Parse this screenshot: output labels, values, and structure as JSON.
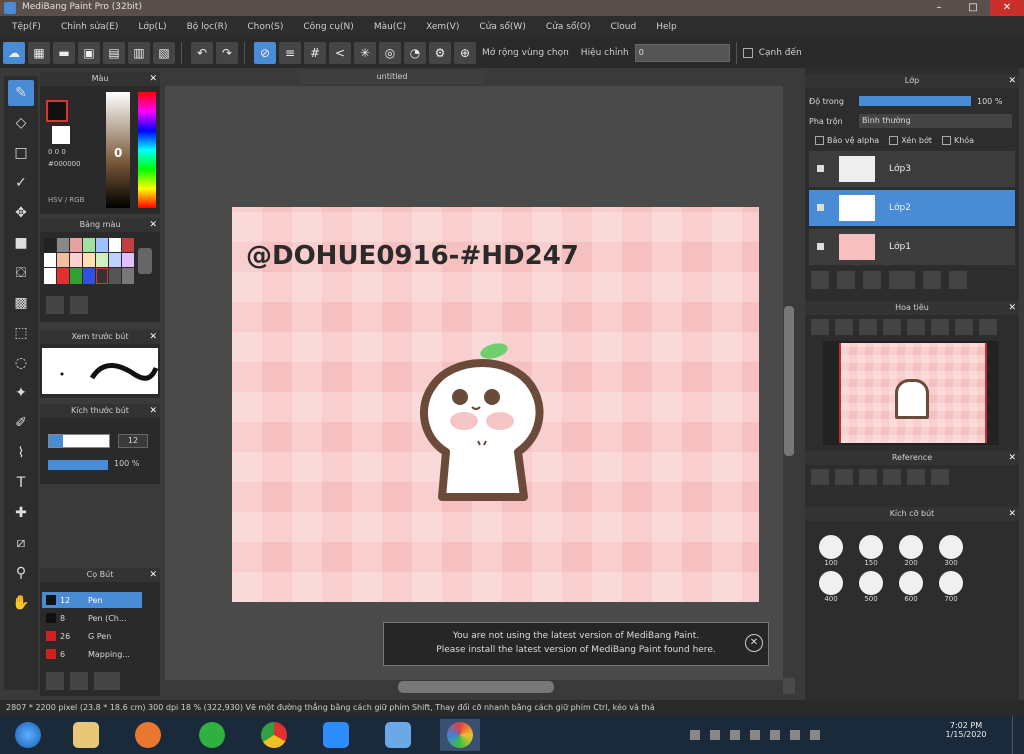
{
  "title_bar": {
    "title": "MediBang Paint Pro (32bit)"
  },
  "window_controls": {
    "minimize": "–",
    "maximize": "□",
    "close": "✕"
  },
  "menu": [
    "Tệp(F)",
    "Chỉnh sửa(E)",
    "Lớp(L)",
    "Bộ lọc(R)",
    "Chọn(S)",
    "Công cụ(N)",
    "Màu(C)",
    "Xem(V)",
    "Cửa sổ(W)",
    "Cửa sổ(O)",
    "Cloud",
    "Help"
  ],
  "toolbar": {
    "undo_icon": "↶",
    "redo_icon": "↷",
    "antialias_label": "Mở rộng vùng chọn",
    "correction_label": "Hiệu chỉnh",
    "correction_value": "0",
    "snap_label": "Cạnh đến"
  },
  "canvas_tab": "untitled",
  "left_panels": {
    "color": {
      "title": "Màu",
      "value": "0",
      "rgb_line1": "0 0 0",
      "hex": "#000000",
      "mode_toggle": "HSV / RGB"
    },
    "palette": {
      "title": "Bảng màu"
    },
    "brush_preview": {
      "title": "Xem trước bút"
    },
    "brush_size": {
      "title": "Kích thước bút",
      "size_value": "12",
      "opacity_value": "100 %"
    },
    "brushes": {
      "title": "Cọ Bút",
      "items": [
        {
          "size": "12",
          "name": "Pen"
        },
        {
          "size": "8",
          "name": "Pen (Ch..."
        },
        {
          "size": "26",
          "name": "G Pen"
        },
        {
          "size": "6",
          "name": "Mapping..."
        }
      ]
    }
  },
  "artboard": {
    "watermark_text": "@DOHUE0916-#HD247"
  },
  "right_panels": {
    "layers": {
      "title": "Lớp",
      "opacity_label": "Độ trong",
      "opacity_value": "100 %",
      "blend_label": "Pha trộn",
      "blend_value": "Bình thường",
      "options": [
        "Bảo vệ alpha",
        "Xén bớt",
        "Khóa"
      ],
      "items": [
        {
          "name": "Lớp3",
          "selected": false
        },
        {
          "name": "Lớp2",
          "selected": true
        },
        {
          "name": "Lớp1",
          "selected": false
        }
      ]
    },
    "navigator": {
      "title": "Hoa tiêu"
    },
    "reference": {
      "title": "Reference"
    },
    "brush_size_panel": {
      "title": "Kích cỡ bút",
      "sizes": [
        "100",
        "150",
        "200",
        "300",
        "400",
        "500",
        "600",
        "700"
      ]
    }
  },
  "notice": {
    "line1": "You are not using the latest version of MediBang Paint.",
    "line2": "Please install the latest version of MediBang Paint found here."
  },
  "status_bar": {
    "text": "2807 * 2200 pixel  (23.8 * 18.6 cm)  300 dpi  18 %  (322,930)  Vẽ một đường thẳng bằng cách giữ phím Shift, Thay đổi cỡ nhanh bằng cách giữ phím Ctrl, kéo và thả"
  },
  "taskbar": {
    "time": "7:02 PM",
    "date": "1/15/2020"
  },
  "colors": {
    "accent": "#4a8bd6",
    "canvas_pink": "#f7c0c0",
    "character_brown": "#6b4a3a",
    "leaf_green": "#6fcf6f"
  }
}
